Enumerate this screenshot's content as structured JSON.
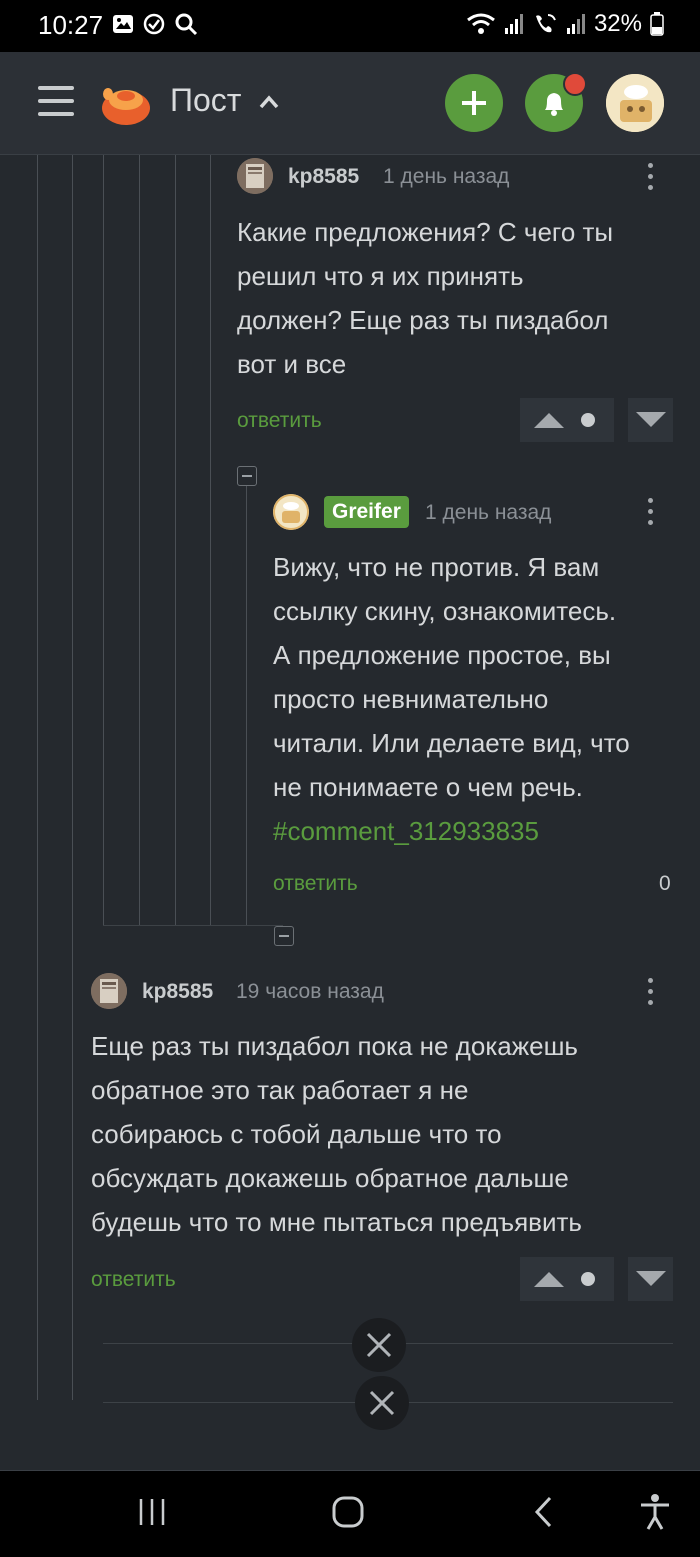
{
  "status_bar": {
    "time": "10:27",
    "battery": "32%"
  },
  "header": {
    "title": "Пост"
  },
  "comments": [
    {
      "user": "kp8585",
      "time": "1 день назад",
      "lines": [
        "Какие предложения? С чего ты",
        "решил что я их принять",
        "должен? Еще раз ты пиздабол",
        "вот и все"
      ],
      "reply": "ответить"
    },
    {
      "user": "Greifer",
      "time": "1 день назад",
      "lines": [
        "Вижу, что не против. Я вам",
        "ссылку скину, ознакомитесь.",
        "А предложение простое, вы",
        "просто невнимательно",
        "читали. Или делаете вид, что",
        "не понимаете о чем речь."
      ],
      "link": "#comment_312933835",
      "reply": "ответить",
      "score": "0"
    },
    {
      "user": "kp8585",
      "time": "19 часов назад",
      "lines": [
        "Еще раз ты пиздабол пока не докажешь",
        "обратное это так работает я не",
        "собираюсь с тобой дальше что то",
        "обсуждать докажешь обратное дальше",
        "будешь что то мне пытаться предъявить"
      ],
      "reply": "ответить"
    }
  ],
  "colors": {
    "accent": "#5a9c3e",
    "background": "#25292e",
    "notification": "#e04a3a"
  }
}
